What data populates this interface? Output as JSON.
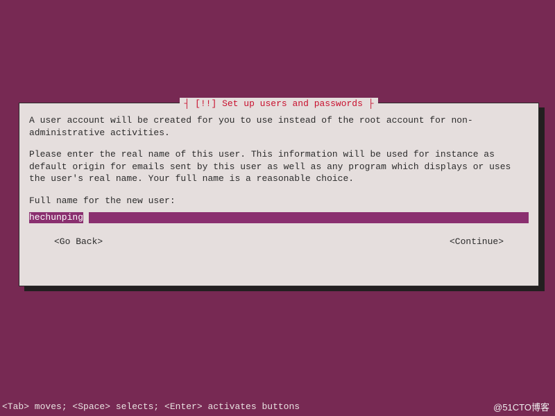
{
  "dialog": {
    "title": "┤ [!!] Set up users and passwords ├",
    "para1": "A user account will be created for you to use instead of the root account for non-administrative activities.",
    "para2": "Please enter the real name of this user. This information will be used for instance as default origin for emails sent by this user as well as any program which displays or uses the user's real name. Your full name is a reasonable choice.",
    "prompt": "Full name for the new user:",
    "input_value": "hechunping",
    "go_back": "<Go Back>",
    "continue": "<Continue>"
  },
  "footer": "<Tab> moves; <Space> selects; <Enter> activates buttons",
  "watermark": "@51CTO博客",
  "colors": {
    "background": "#772953",
    "panel": "#e5dedd",
    "title": "#c8102e",
    "input_bg": "#8a2f6f"
  }
}
